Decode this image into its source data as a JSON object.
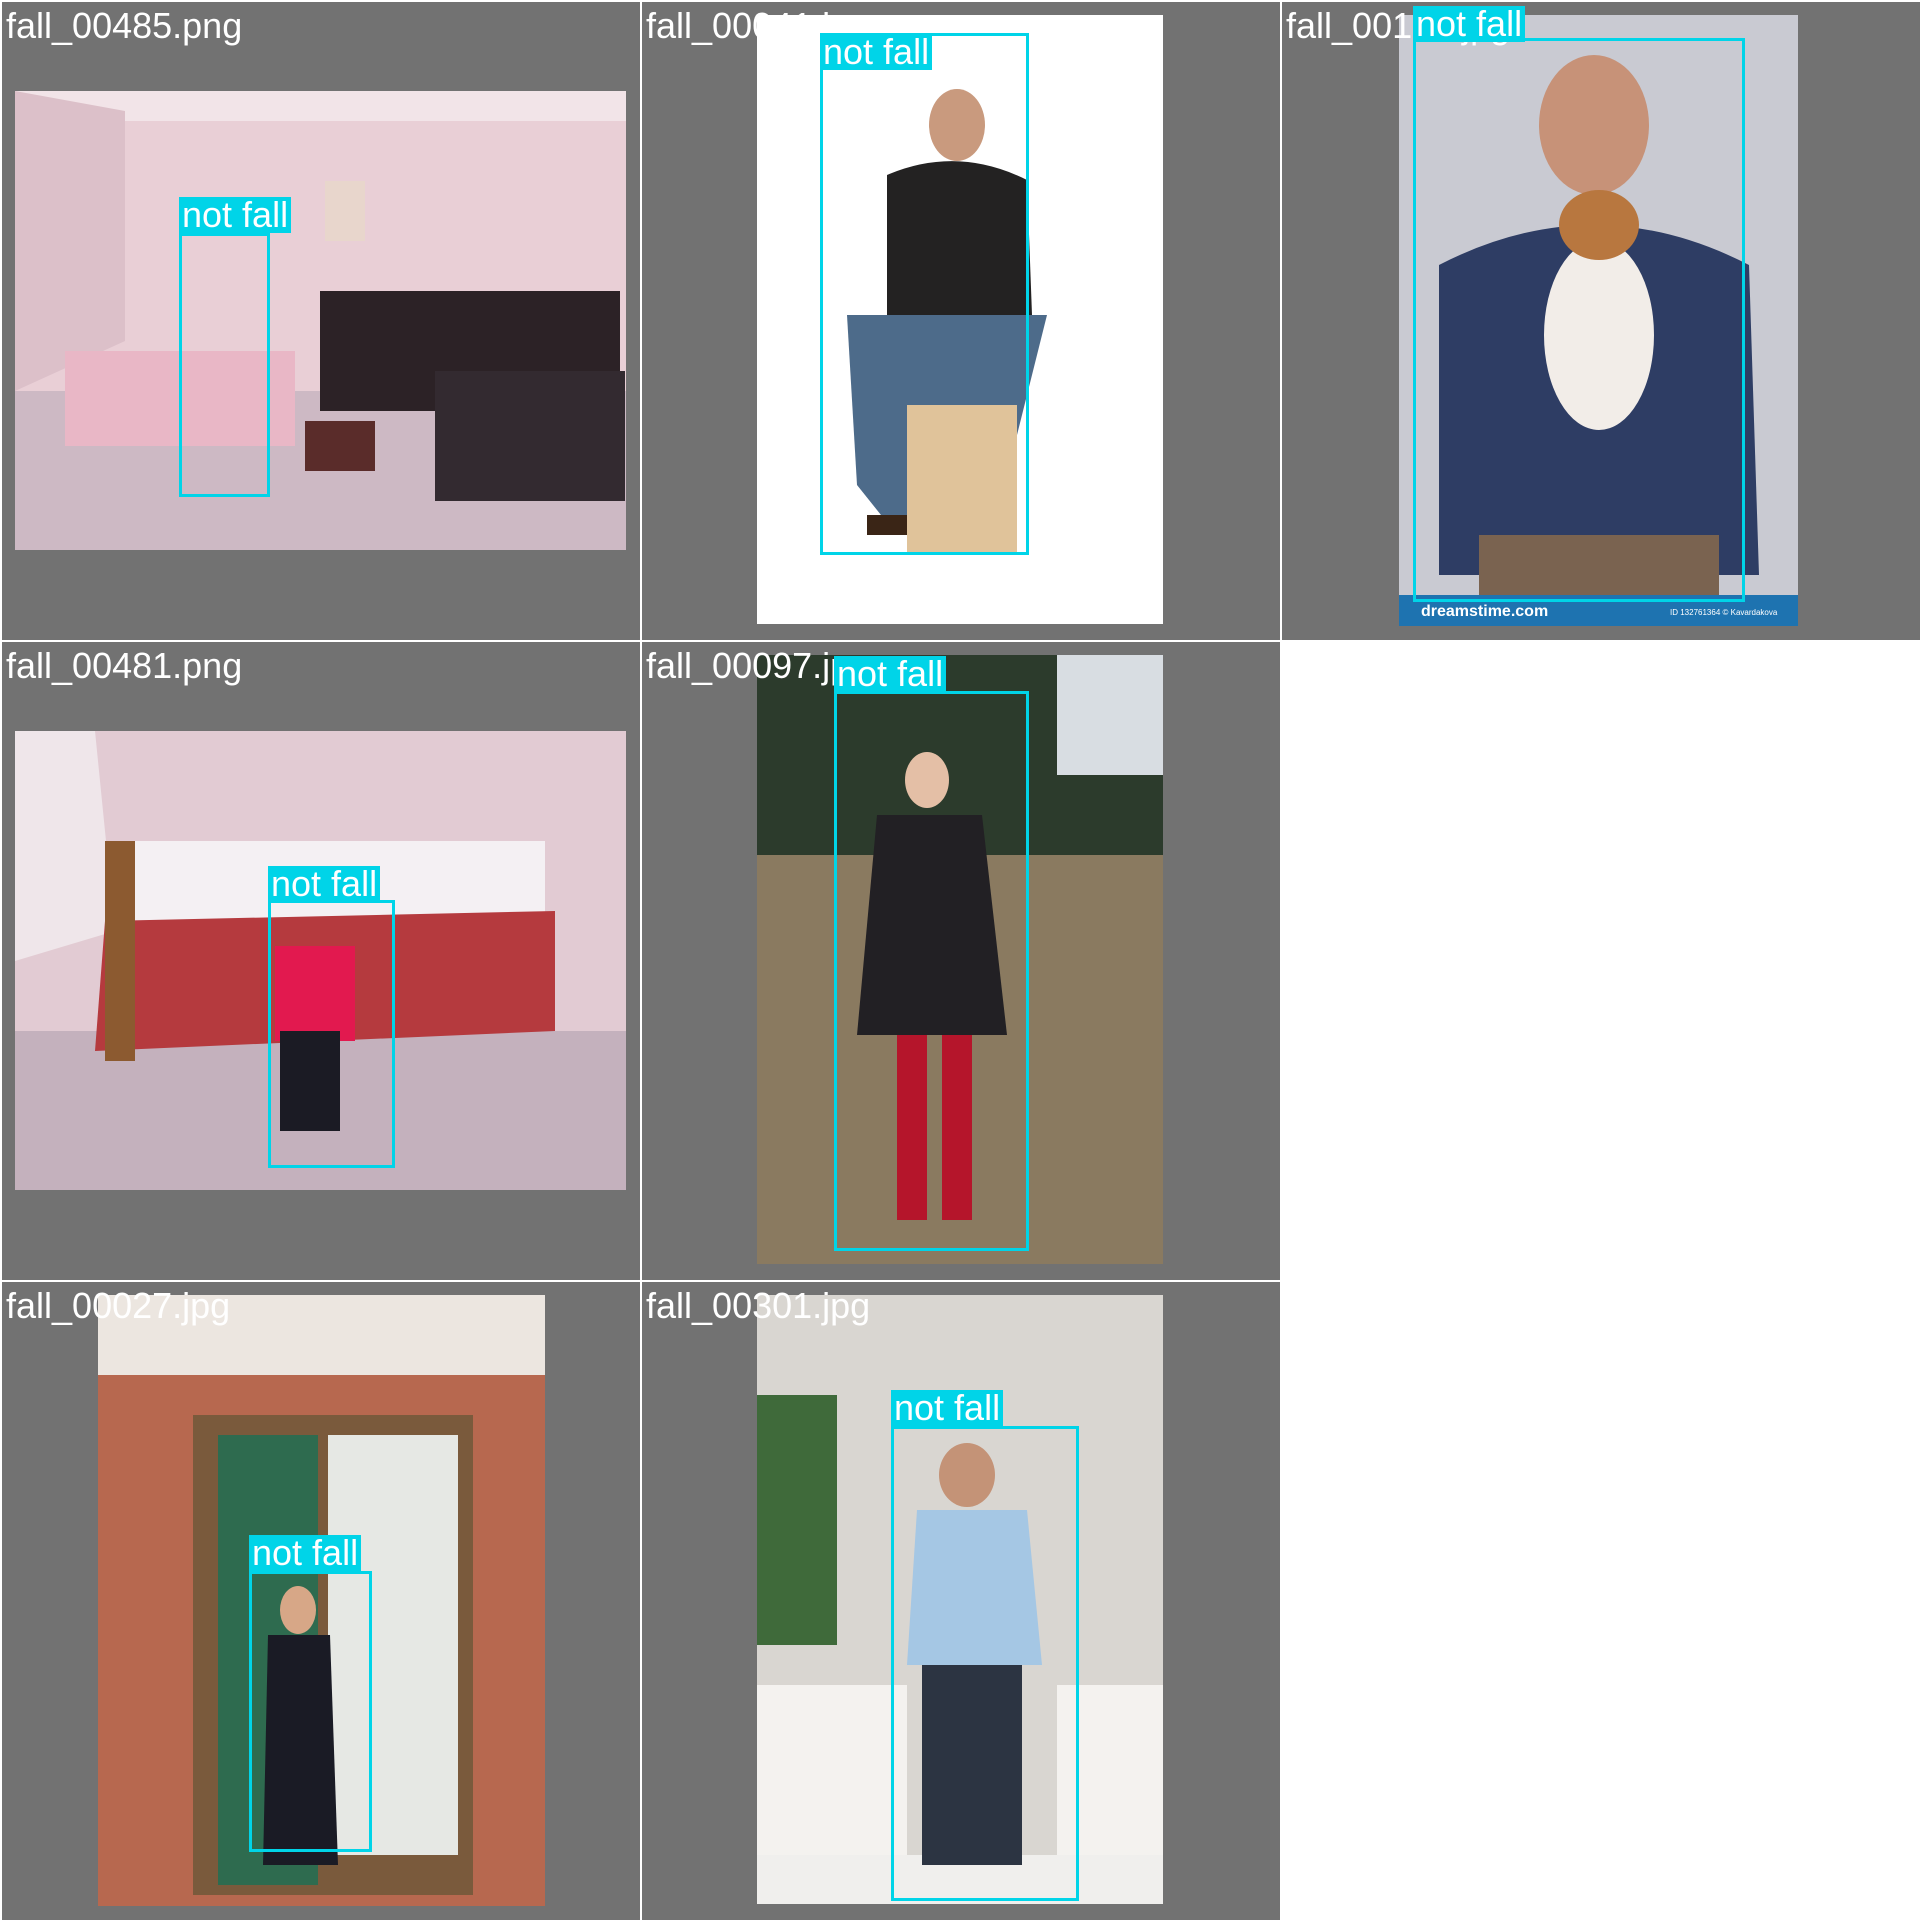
{
  "grid": {
    "background": "#727272",
    "box_color": "#00d4e8",
    "cells": [
      {
        "filename": "fall_00485.png",
        "detections": [
          {
            "label": "not fall"
          }
        ]
      },
      {
        "filename": "fall_00041.jpg",
        "detections": [
          {
            "label": "not fall"
          }
        ]
      },
      {
        "filename": "fall_00132.jpg",
        "detections": [
          {
            "label": "not fall"
          }
        ]
      },
      {
        "filename": "fall_00481.png",
        "detections": [
          {
            "label": "not fall"
          }
        ]
      },
      {
        "filename": "fall_00097.jpg",
        "detections": [
          {
            "label": "not fall"
          }
        ]
      },
      {
        "filename": "fall_00027.jpg",
        "detections": [
          {
            "label": "not fall"
          }
        ]
      },
      {
        "filename": "fall_00301.jpg",
        "detections": [
          {
            "label": "not fall"
          }
        ]
      }
    ]
  },
  "watermark": {
    "brand": "dreamstime.com",
    "credit": "ID 132761364 © Kavardakova"
  }
}
